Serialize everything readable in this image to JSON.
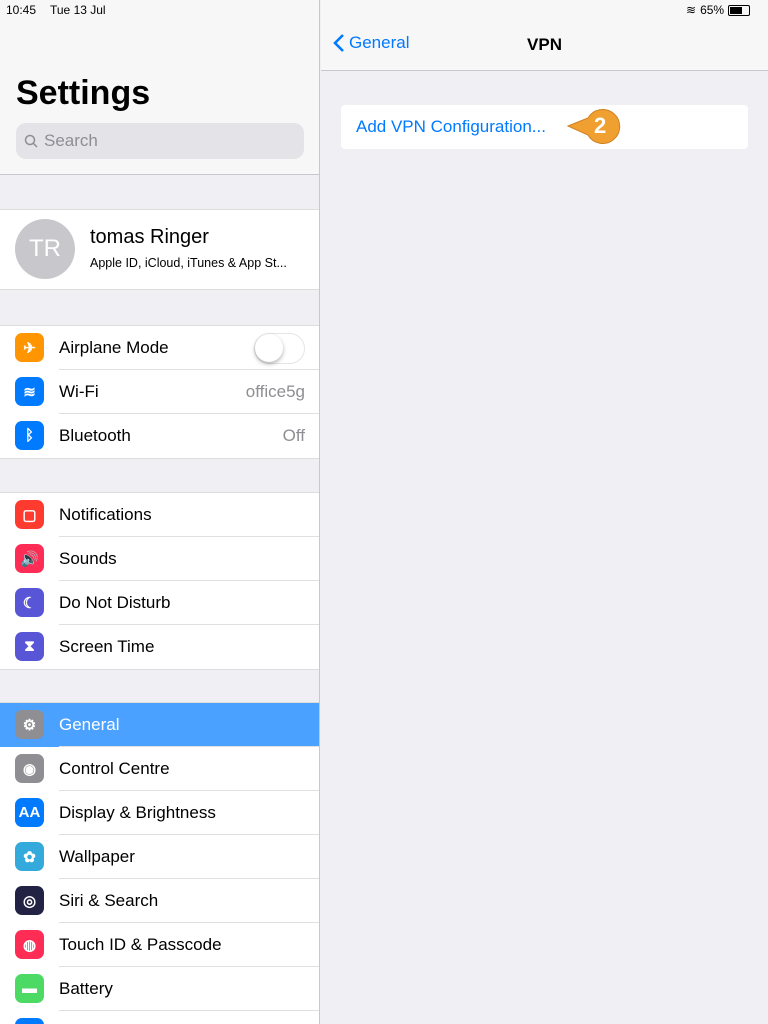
{
  "status": {
    "time": "10:45",
    "date": "Tue 13 Jul",
    "battery": "65%",
    "battery_level": 0.65
  },
  "sidebar": {
    "title": "Settings",
    "search_placeholder": "Search",
    "profile": {
      "initials": "TR",
      "name": "tomas Ringer",
      "subtitle": "Apple ID, iCloud, iTunes & App St..."
    },
    "groups": [
      [
        {
          "label": "Airplane Mode",
          "icon": "airplane-icon",
          "color": "#ff9500",
          "glyph": "✈",
          "toggle": false
        },
        {
          "label": "Wi-Fi",
          "icon": "wifi-icon",
          "color": "#007aff",
          "glyph": "≋",
          "value": "office5g"
        },
        {
          "label": "Bluetooth",
          "icon": "bluetooth-icon",
          "color": "#007aff",
          "glyph": "ᛒ",
          "value": "Off"
        }
      ],
      [
        {
          "label": "Notifications",
          "icon": "notifications-icon",
          "color": "#ff3b30",
          "glyph": "▢"
        },
        {
          "label": "Sounds",
          "icon": "sounds-icon",
          "color": "#ff2d55",
          "glyph": "🔊"
        },
        {
          "label": "Do Not Disturb",
          "icon": "moon-icon",
          "color": "#5856d6",
          "glyph": "☾"
        },
        {
          "label": "Screen Time",
          "icon": "hourglass-icon",
          "color": "#5856d6",
          "glyph": "⧗"
        }
      ],
      [
        {
          "label": "General",
          "icon": "gear-icon",
          "color": "#8e8e93",
          "glyph": "⚙",
          "selected": true
        },
        {
          "label": "Control Centre",
          "icon": "control-centre-icon",
          "color": "#8e8e93",
          "glyph": "◉"
        },
        {
          "label": "Display & Brightness",
          "icon": "display-icon",
          "color": "#007aff",
          "glyph": "AA"
        },
        {
          "label": "Wallpaper",
          "icon": "wallpaper-icon",
          "color": "#34aadc",
          "glyph": "✿"
        },
        {
          "label": "Siri & Search",
          "icon": "siri-icon",
          "color": "#222244",
          "glyph": "◎"
        },
        {
          "label": "Touch ID & Passcode",
          "icon": "fingerprint-icon",
          "color": "#ff2d55",
          "glyph": "◍"
        },
        {
          "label": "Battery",
          "icon": "battery-icon",
          "color": "#4cd964",
          "glyph": "▬"
        },
        {
          "label": "",
          "icon": "privacy-icon",
          "color": "#007aff",
          "glyph": ""
        }
      ]
    ]
  },
  "detail": {
    "back_label": "General",
    "title": "VPN",
    "add_label": "Add VPN Configuration...",
    "callout_number": "2",
    "callout_color": "#f0a030"
  }
}
